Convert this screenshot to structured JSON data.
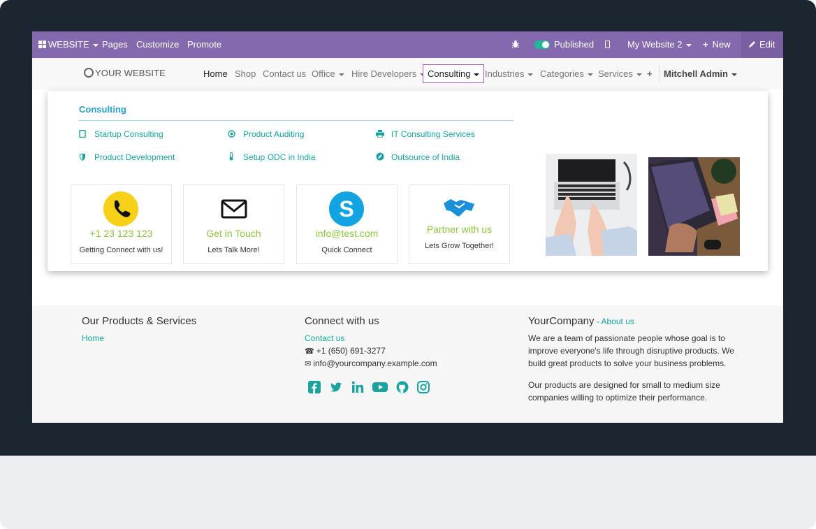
{
  "adminbar": {
    "website_label": "WEBSITE",
    "pages": "Pages",
    "customize": "Customize",
    "promote": "Promote",
    "published": "Published",
    "my_website": "My Website 2",
    "new": "New",
    "edit": "Edit"
  },
  "navbar": {
    "logo": "YOUR WEBSITE",
    "items": [
      "Home",
      "Shop",
      "Contact us",
      "Office",
      "Hire Developers",
      "Consulting",
      "Industries",
      "Categories",
      "Services"
    ],
    "user": "Mitchell Admin"
  },
  "mega": {
    "heading": "Consulting",
    "links": [
      {
        "label": "Startup Consulting",
        "icon": "tablet-icon"
      },
      {
        "label": "Product Auditing",
        "icon": "dot-circle-icon"
      },
      {
        "label": "IT Consulting Services",
        "icon": "print-icon"
      },
      {
        "label": "Product Development",
        "icon": "shield-icon"
      },
      {
        "label": "Setup ODC in India",
        "icon": "thermometer-icon"
      },
      {
        "label": "Outsource of India",
        "icon": "compass-icon"
      }
    ],
    "cards": [
      {
        "big": "+1 23 123 123",
        "small": "Getting Connect with us!",
        "icon": "phone-icon"
      },
      {
        "big": "Get in Touch",
        "small": "Lets Talk More!",
        "icon": "envelope-icon"
      },
      {
        "big": "info@test.com",
        "small": "Quick Connect",
        "icon": "skype-icon"
      },
      {
        "big": "Partner with us",
        "small": "Lets Grow Together!",
        "icon": "handshake-icon"
      }
    ]
  },
  "footer": {
    "col1_title": "Our Products & Services",
    "col1_link": "Home",
    "col2_title": "Connect with us",
    "col2_link": "Contact us",
    "phone": "+1 (650) 691-3277",
    "email": "info@yourcompany.example.com",
    "col3_title": "YourCompany",
    "col3_sep": " - ",
    "col3_link": "About us",
    "para1": "We are a team of passionate people whose goal is to improve everyone's life through disruptive products. We build great products to solve your business problems.",
    "para2": "Our products are designed for small to medium size companies willing to optimize their performance.",
    "social_icons": [
      "facebook-icon",
      "twitter-icon",
      "linkedin-icon",
      "youtube-icon",
      "github-icon",
      "instagram-icon"
    ]
  },
  "colors": {
    "admin_bar": "#8569ae",
    "accent": "#19a4a0",
    "heading_blue": "#2aa0c4",
    "card_green": "#8cc63f",
    "monitor": "#1b2631"
  }
}
